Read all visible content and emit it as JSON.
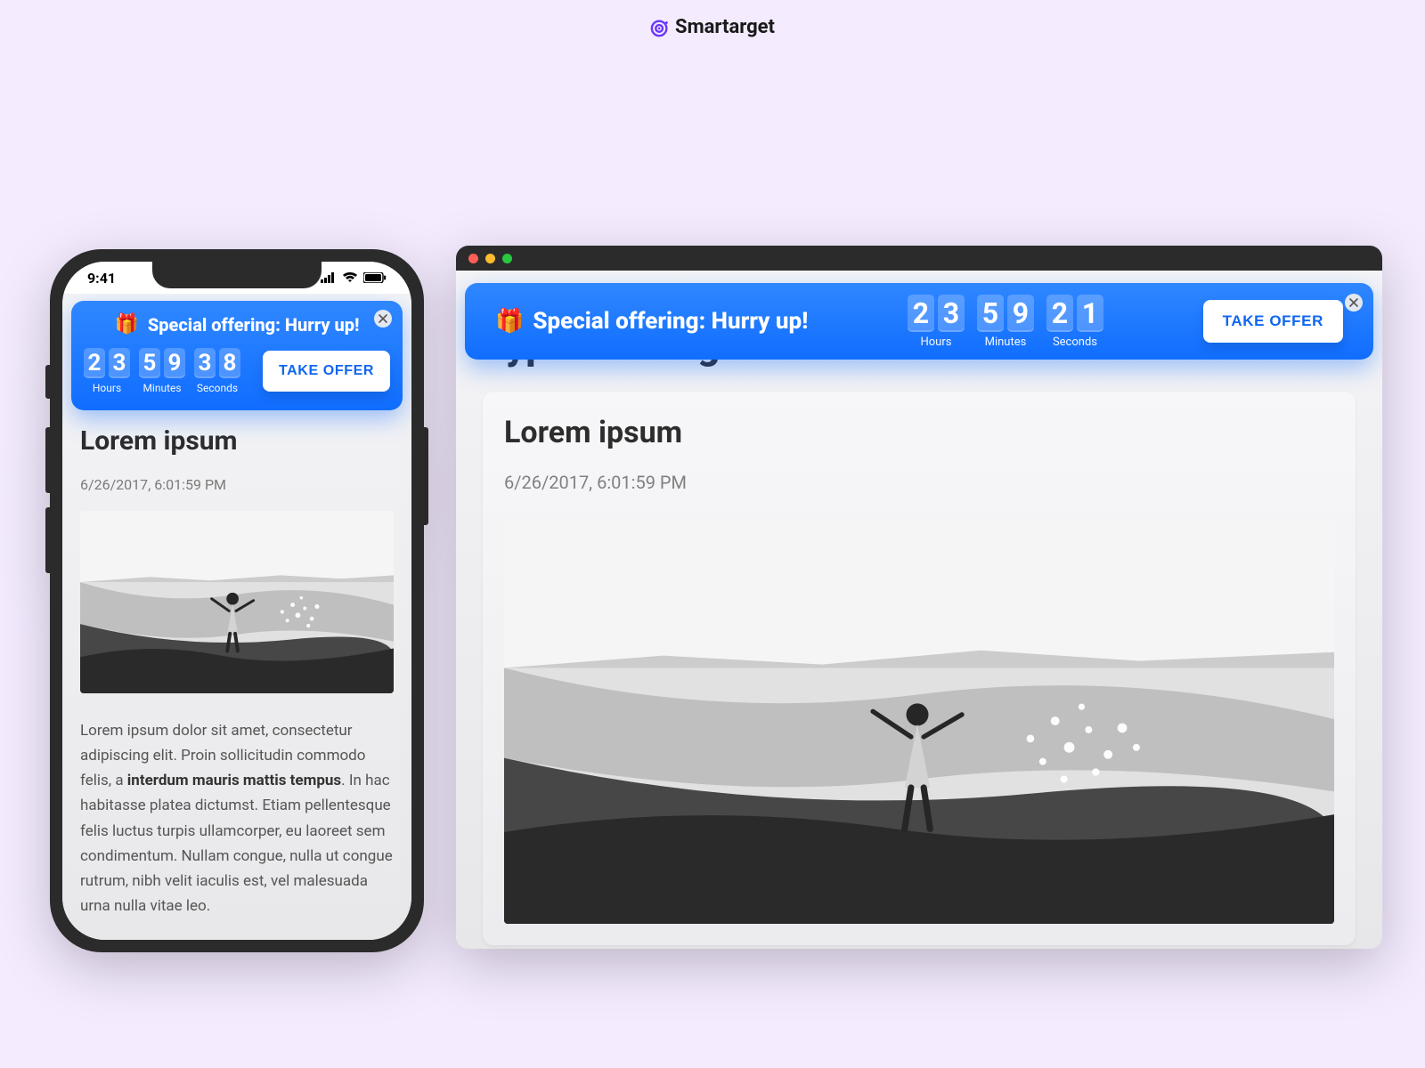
{
  "logo": {
    "name": "Smartarget"
  },
  "phone": {
    "status": {
      "time": "9:41"
    },
    "banner": {
      "emoji": "🎁",
      "title": "Special offering: Hurry up!",
      "hours_label": "Hours",
      "minutes_label": "Minutes",
      "seconds_label": "Seconds",
      "hours": [
        "2",
        "3"
      ],
      "minutes": [
        "5",
        "9"
      ],
      "seconds": [
        "3",
        "8"
      ],
      "cta": "TAKE OFFER"
    },
    "article": {
      "title": "Lorem ipsum",
      "date": "6/26/2017, 6:01:59 PM",
      "body_pre": "Lorem ipsum dolor sit amet, consectetur adipiscing elit. Proin sollicitudin commodo felis, a ",
      "body_strong": "interdum mauris mattis tempus",
      "body_post": ". In hac habitasse platea dictumst. Etiam pellentesque felis luctus turpis ullamcorper, eu laoreet sem condimentum. Nullam congue, nulla ut congue rutrum, nibh velit iaculis est, vel malesuada urna nulla vitae leo."
    }
  },
  "desktop": {
    "banner": {
      "emoji": "🎁",
      "title": "Special offering: Hurry up!",
      "hours_label": "Hours",
      "minutes_label": "Minutes",
      "seconds_label": "Seconds",
      "hours": [
        "2",
        "3"
      ],
      "minutes": [
        "5",
        "9"
      ],
      "seconds": [
        "2",
        "1"
      ],
      "cta": "TAKE OFFER"
    },
    "page_heading": "Typical Design",
    "article": {
      "title": "Lorem ipsum",
      "date": "6/26/2017, 6:01:59 PM"
    }
  }
}
